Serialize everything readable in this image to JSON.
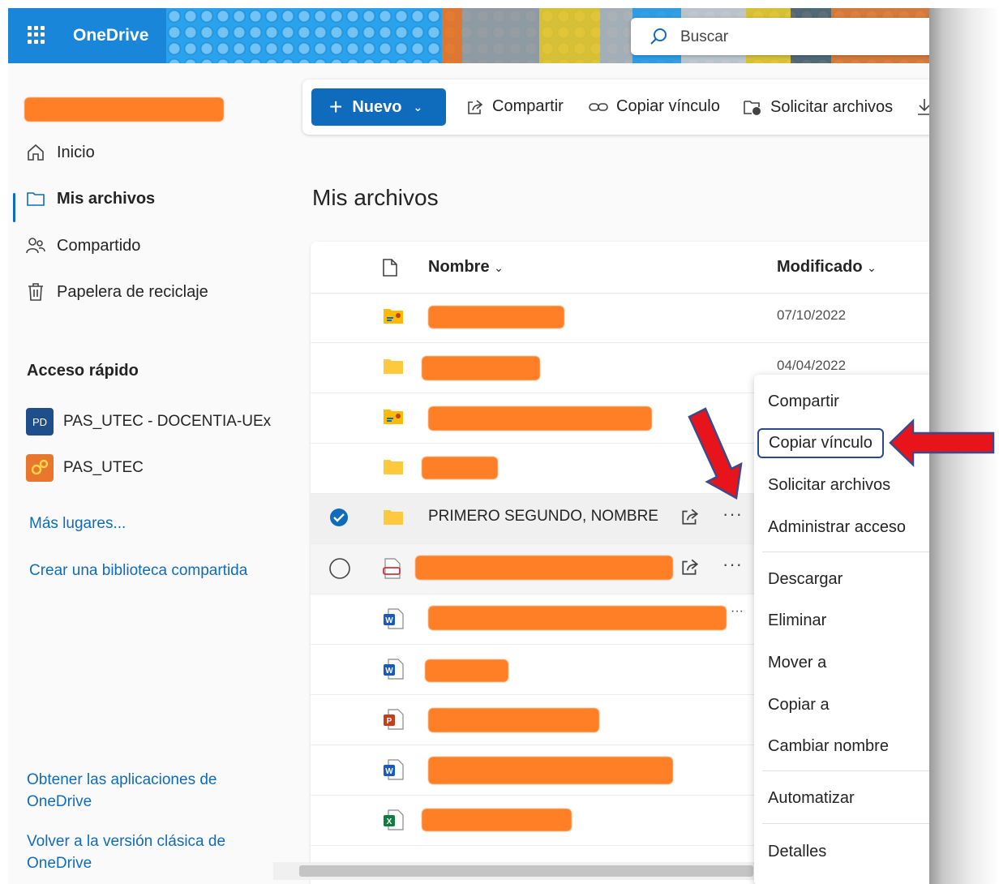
{
  "app": {
    "name": "OneDrive"
  },
  "search": {
    "placeholder": "Buscar"
  },
  "sidebar": {
    "nav": [
      {
        "label": "Inicio",
        "icon": "home-icon"
      },
      {
        "label": "Mis archivos",
        "icon": "folder-icon",
        "selected": true
      },
      {
        "label": "Compartido",
        "icon": "people-icon"
      },
      {
        "label": "Papelera de reciclaje",
        "icon": "trash-icon"
      }
    ],
    "quick_access_title": "Acceso rápido",
    "quick_access": [
      {
        "label": "PAS_UTEC - DOCENTIA-UEx",
        "tile": "PD",
        "color": "#1f4e8c"
      },
      {
        "label": "PAS_UTEC",
        "tile": "",
        "color": "#e8762d"
      }
    ],
    "more_places": "Más lugares...",
    "create_library": "Crear una biblioteca compartida",
    "get_apps": "Obtener las aplicaciones de OneDrive",
    "classic": "Volver a la versión clásica de OneDrive"
  },
  "commandbar": {
    "new": "Nuevo",
    "share": "Compartir",
    "copy_link": "Copiar vínculo",
    "request_files": "Solicitar archivos"
  },
  "page_title": "Mis archivos",
  "columns": {
    "name": "Nombre",
    "modified": "Modificado"
  },
  "rows": [
    {
      "type": "shared-folder",
      "name": "",
      "date": "07/10/2022"
    },
    {
      "type": "folder",
      "name": "",
      "date": "04/04/2022"
    },
    {
      "type": "shared-folder",
      "name": "",
      "date": ""
    },
    {
      "type": "folder",
      "name": "",
      "date": ""
    },
    {
      "type": "folder",
      "name": "PRIMERO SEGUNDO, NOMBRE",
      "date": "",
      "selected": true
    },
    {
      "type": "pdf",
      "name": "",
      "date": ""
    },
    {
      "type": "word",
      "name": "",
      "date": ""
    },
    {
      "type": "word",
      "name": "",
      "date": ""
    },
    {
      "type": "powerpoint",
      "name": "",
      "date": ""
    },
    {
      "type": "word",
      "name": "",
      "date": ""
    },
    {
      "type": "excel",
      "name": "",
      "date": ""
    }
  ],
  "context_menu": [
    "Compartir",
    "Copiar vínculo",
    "Solicitar archivos",
    "Administrar acceso",
    "Descargar",
    "Eliminar",
    "Mover a",
    "Copiar a",
    "Cambiar nombre",
    "Automatizar",
    "Detalles"
  ],
  "colors": {
    "accent": "#0f6cbd",
    "arrow": "#e8141b",
    "redaction": "#ff7f27"
  }
}
